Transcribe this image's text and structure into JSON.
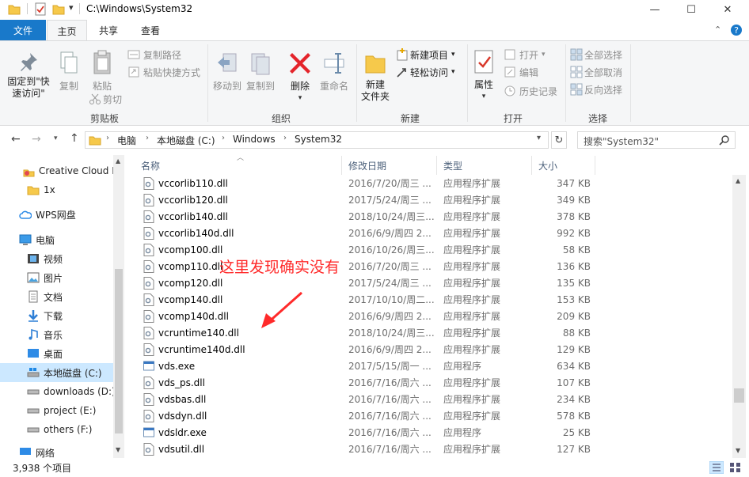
{
  "window": {
    "title": "C:\\Windows\\System32",
    "minimize": "—",
    "maximize": "☐",
    "close": "✕"
  },
  "ribbon_tabs": [
    {
      "label": "文件"
    },
    {
      "label": "主页"
    },
    {
      "label": "共享"
    },
    {
      "label": "查看"
    }
  ],
  "ribbon": {
    "clipboard": {
      "pin_line1": "固定到\"快",
      "pin_line2": "速访问\"",
      "copy": "复制",
      "paste": "粘贴",
      "copy_path": "复制路径",
      "paste_shortcut": "粘贴快捷方式",
      "cut": "剪切",
      "group": "剪贴板"
    },
    "organize": {
      "move_to": "移动到",
      "copy_to": "复制到",
      "delete": "删除",
      "rename": "重命名",
      "group": "组织"
    },
    "new": {
      "new_folder_line1": "新建",
      "new_folder_line2": "文件夹",
      "new_item": "新建项目",
      "easy_access": "轻松访问",
      "group": "新建"
    },
    "open": {
      "properties": "属性",
      "open": "打开",
      "edit": "编辑",
      "history": "历史记录",
      "group": "打开"
    },
    "select": {
      "select_all": "全部选择",
      "select_none": "全部取消",
      "invert": "反向选择",
      "group": "选择"
    }
  },
  "address": {
    "crumbs": [
      "电脑",
      "本地磁盘 (C:)",
      "Windows",
      "System32"
    ],
    "search_placeholder": "搜索\"System32\""
  },
  "nav": [
    {
      "label": "Creative Cloud F",
      "icon": "creative-cloud-icon"
    },
    {
      "label": "1x",
      "icon": "folder-icon"
    },
    {
      "label": "WPS网盘",
      "icon": "cloud-icon"
    },
    {
      "label": "电脑",
      "icon": "computer-icon"
    },
    {
      "label": "视频",
      "icon": "video-icon"
    },
    {
      "label": "图片",
      "icon": "picture-icon"
    },
    {
      "label": "文档",
      "icon": "document-icon"
    },
    {
      "label": "下载",
      "icon": "download-icon"
    },
    {
      "label": "音乐",
      "icon": "music-icon"
    },
    {
      "label": "桌面",
      "icon": "desktop-icon"
    },
    {
      "label": "本地磁盘 (C:)",
      "icon": "drive-icon"
    },
    {
      "label": "downloads (D:)",
      "icon": "drive-icon"
    },
    {
      "label": "project (E:)",
      "icon": "drive-icon"
    },
    {
      "label": "others (F:)",
      "icon": "drive-icon"
    },
    {
      "label": "网络",
      "icon": "network-icon"
    }
  ],
  "columns": {
    "name": "名称",
    "date": "修改日期",
    "type": "类型",
    "size": "大小"
  },
  "files": [
    {
      "name": "vccorlib110.dll",
      "date": "2016/7/20/周三 ...",
      "type": "应用程序扩展",
      "size": "347 KB",
      "kind": "dll"
    },
    {
      "name": "vccorlib120.dll",
      "date": "2017/5/24/周三 ...",
      "type": "应用程序扩展",
      "size": "349 KB",
      "kind": "dll"
    },
    {
      "name": "vccorlib140.dll",
      "date": "2018/10/24/周三...",
      "type": "应用程序扩展",
      "size": "378 KB",
      "kind": "dll"
    },
    {
      "name": "vccorlib140d.dll",
      "date": "2016/6/9/周四 2...",
      "type": "应用程序扩展",
      "size": "992 KB",
      "kind": "dll"
    },
    {
      "name": "vcomp100.dll",
      "date": "2016/10/26/周三...",
      "type": "应用程序扩展",
      "size": "58 KB",
      "kind": "dll"
    },
    {
      "name": "vcomp110.dll",
      "date": "2016/7/20/周三 ...",
      "type": "应用程序扩展",
      "size": "136 KB",
      "kind": "dll"
    },
    {
      "name": "vcomp120.dll",
      "date": "2017/5/24/周三 ...",
      "type": "应用程序扩展",
      "size": "135 KB",
      "kind": "dll"
    },
    {
      "name": "vcomp140.dll",
      "date": "2017/10/10/周二...",
      "type": "应用程序扩展",
      "size": "153 KB",
      "kind": "dll"
    },
    {
      "name": "vcomp140d.dll",
      "date": "2016/6/9/周四 2...",
      "type": "应用程序扩展",
      "size": "209 KB",
      "kind": "dll"
    },
    {
      "name": "vcruntime140.dll",
      "date": "2018/10/24/周三...",
      "type": "应用程序扩展",
      "size": "88 KB",
      "kind": "dll"
    },
    {
      "name": "vcruntime140d.dll",
      "date": "2016/6/9/周四 2...",
      "type": "应用程序扩展",
      "size": "129 KB",
      "kind": "dll"
    },
    {
      "name": "vds.exe",
      "date": "2017/5/15/周一 ...",
      "type": "应用程序",
      "size": "634 KB",
      "kind": "exe"
    },
    {
      "name": "vds_ps.dll",
      "date": "2016/7/16/周六 ...",
      "type": "应用程序扩展",
      "size": "107 KB",
      "kind": "dll"
    },
    {
      "name": "vdsbas.dll",
      "date": "2016/7/16/周六 ...",
      "type": "应用程序扩展",
      "size": "234 KB",
      "kind": "dll"
    },
    {
      "name": "vdsdyn.dll",
      "date": "2016/7/16/周六 ...",
      "type": "应用程序扩展",
      "size": "578 KB",
      "kind": "dll"
    },
    {
      "name": "vdsldr.exe",
      "date": "2016/7/16/周六 ...",
      "type": "应用程序",
      "size": "25 KB",
      "kind": "exe"
    },
    {
      "name": "vdsutil.dll",
      "date": "2016/7/16/周六 ...",
      "type": "应用程序扩展",
      "size": "127 KB",
      "kind": "dll"
    }
  ],
  "annotation": "这里发现确实没有",
  "status": {
    "count": "3,938 个项目"
  },
  "colors": {
    "accent": "#1979ca",
    "selection": "#cce8ff",
    "annotation": "#ff2a2a"
  }
}
